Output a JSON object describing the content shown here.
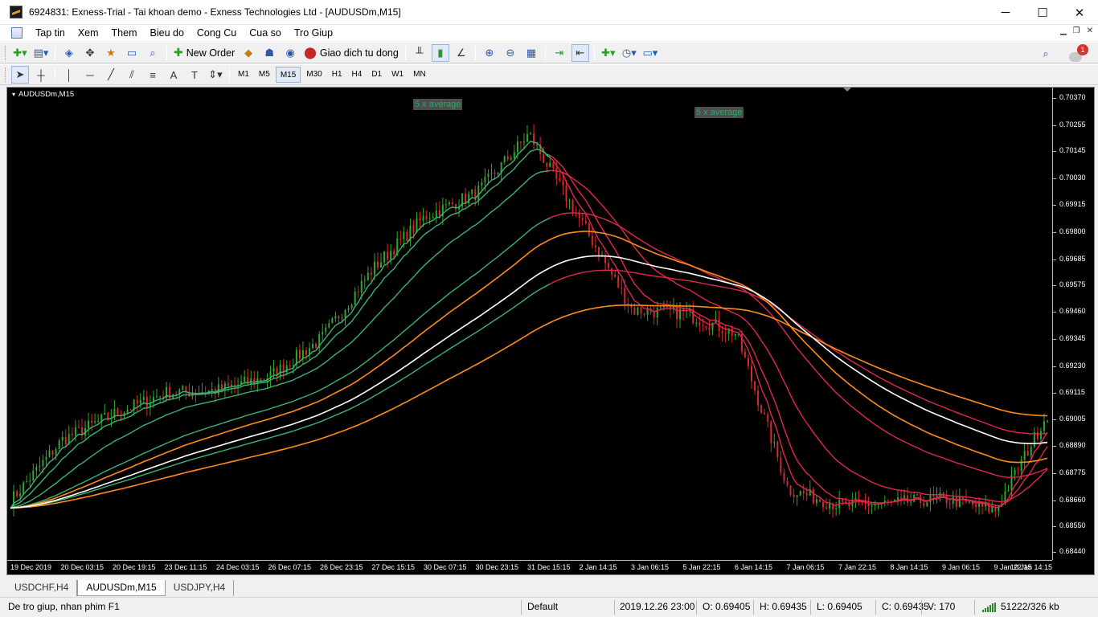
{
  "window": {
    "title": "6924831: Exness-Trial - Tai khoan demo - Exness Technologies Ltd - [AUDUSDm,M15]",
    "minimize": "─",
    "maximize": "☐",
    "close": "✕"
  },
  "menu": {
    "items": [
      "Tap tin",
      "Xem",
      "Them",
      "Bieu do",
      "Cong Cu",
      "Cua so",
      "Tro Giup"
    ],
    "mdi_minimize": "▁",
    "mdi_restore": "❐",
    "mdi_close": "✕"
  },
  "toolbar": {
    "new_order": "New Order",
    "auto_trading": "Giao dich tu dong",
    "notification_count": "1"
  },
  "timeframes": [
    "M1",
    "M5",
    "M15",
    "M30",
    "H1",
    "H4",
    "D1",
    "W1",
    "MN"
  ],
  "active_timeframe": "M15",
  "chart": {
    "symbol_label": "AUDUSDm,M15",
    "annotations": [
      "5 x average",
      "5 x average"
    ],
    "price_ticks": [
      "0.70370",
      "0.70255",
      "0.70145",
      "0.70030",
      "0.69915",
      "0.69800",
      "0.69685",
      "0.69575",
      "0.69460",
      "0.69345",
      "0.69230",
      "0.69115",
      "0.69005",
      "0.68890",
      "0.68775",
      "0.68660",
      "0.68550",
      "0.68440"
    ],
    "time_ticks": [
      "19 Dec 2019",
      "20 Dec 03:15",
      "20 Dec 19:15",
      "23 Dec 11:15",
      "24 Dec 03:15",
      "26 Dec 07:15",
      "26 Dec 23:15",
      "27 Dec 15:15",
      "30 Dec 07:15",
      "30 Dec 23:15",
      "31 Dec 15:15",
      "2 Jan 14:15",
      "3 Jan 06:15",
      "5 Jan 22:15",
      "6 Jan 14:15",
      "7 Jan 06:15",
      "7 Jan 22:15",
      "8 Jan 14:15",
      "9 Jan 06:15",
      "9 Jan 22:15",
      "10 Jan 14:15"
    ],
    "colors": {
      "background": "#000000",
      "bull_candle": "#2ea82e",
      "bear_candle": "#d32b2b",
      "ma_green": "#3cb371",
      "ma_red": "#e0284a",
      "ma_orange": "#ff8c1a",
      "ma_white": "#ffffff"
    }
  },
  "chart_data": {
    "type": "line",
    "title": "",
    "xlabel": "",
    "ylabel": "",
    "ylim": [
      0.6844,
      0.7037
    ],
    "x": [
      "19 Dec 2019",
      "20 Dec 03:15",
      "20 Dec 19:15",
      "23 Dec 11:15",
      "24 Dec 03:15",
      "26 Dec 07:15",
      "26 Dec 23:15",
      "27 Dec 15:15",
      "30 Dec 07:15",
      "30 Dec 23:15",
      "31 Dec 15:15",
      "2 Jan 14:15",
      "3 Jan 06:15",
      "5 Jan 22:15",
      "6 Jan 14:15",
      "7 Jan 06:15",
      "7 Jan 22:15",
      "8 Jan 14:15",
      "9 Jan 06:15",
      "9 Jan 22:15",
      "10 Jan 14:15"
    ],
    "series": [
      {
        "values": [
          0.6866,
          0.6892,
          0.6903,
          0.6912,
          0.6913,
          0.6919,
          0.6935,
          0.6965,
          0.6987,
          0.6997,
          0.7022,
          0.6985,
          0.6947,
          0.6946,
          0.6937,
          0.6871,
          0.6864,
          0.6865,
          0.6867,
          0.6862,
          0.6903
        ]
      }
    ]
  },
  "tabs": [
    "USDCHF,H4",
    "AUDUSDm,M15",
    "USDJPY,H4"
  ],
  "active_tab": "AUDUSDm,M15",
  "status": {
    "help": "De tro giup, nhan phim F1",
    "profile": "Default",
    "datetime": "2019.12.26 23:00",
    "open": "O: 0.69405",
    "high": "H: 0.69435",
    "low": "L: 0.69405",
    "close": "C: 0.69435",
    "volume": "V: 170",
    "traffic": "51222/326 kb"
  }
}
